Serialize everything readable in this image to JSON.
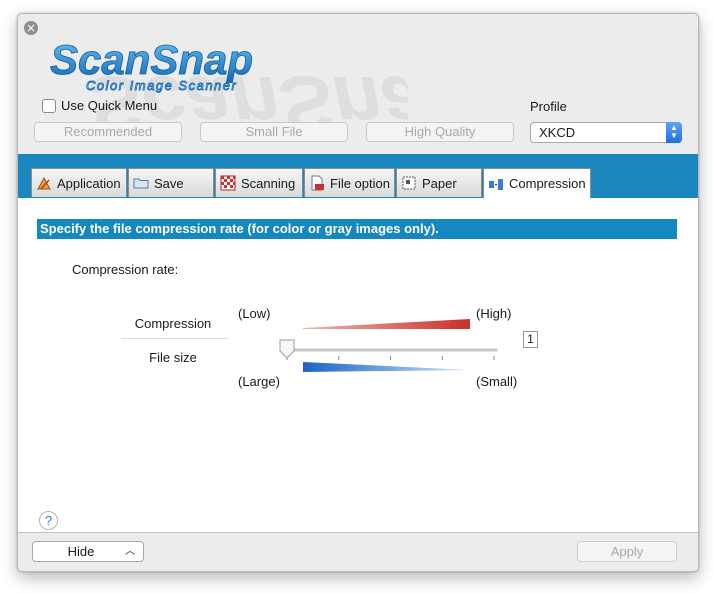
{
  "app": {
    "logo_text": "ScanSnap",
    "logo_subtitle": "Color Image Scanner",
    "brand_color": "#1a87bf"
  },
  "quick_menu": {
    "label": "Use Quick Menu",
    "checked": false
  },
  "presets": {
    "recommended": "Recommended",
    "small_file": "Small File",
    "high_quality": "High Quality"
  },
  "profile": {
    "label": "Profile",
    "value": "XKCD"
  },
  "tabs": [
    {
      "label": "Application",
      "icon": "application-icon",
      "active": false
    },
    {
      "label": "Save",
      "icon": "folder-icon",
      "active": false
    },
    {
      "label": "Scanning",
      "icon": "scanning-icon",
      "active": false
    },
    {
      "label": "File option",
      "icon": "file-option-icon",
      "active": false
    },
    {
      "label": "Paper",
      "icon": "paper-icon",
      "active": false
    },
    {
      "label": "Compression",
      "icon": "compression-icon",
      "active": true
    }
  ],
  "compression": {
    "banner": "Specify the file compression rate (for color or gray images only).",
    "rate_label": "Compression rate:",
    "compression_label": "Compression",
    "file_size_label": "File size",
    "low_label": "(Low)",
    "high_label": "(High)",
    "large_label": "(Large)",
    "small_label": "(Small)",
    "slider_value": "1",
    "slider_min": 1,
    "slider_max": 5
  },
  "help": {
    "label": "?"
  },
  "footer": {
    "hide_label": "Hide",
    "apply_label": "Apply"
  }
}
